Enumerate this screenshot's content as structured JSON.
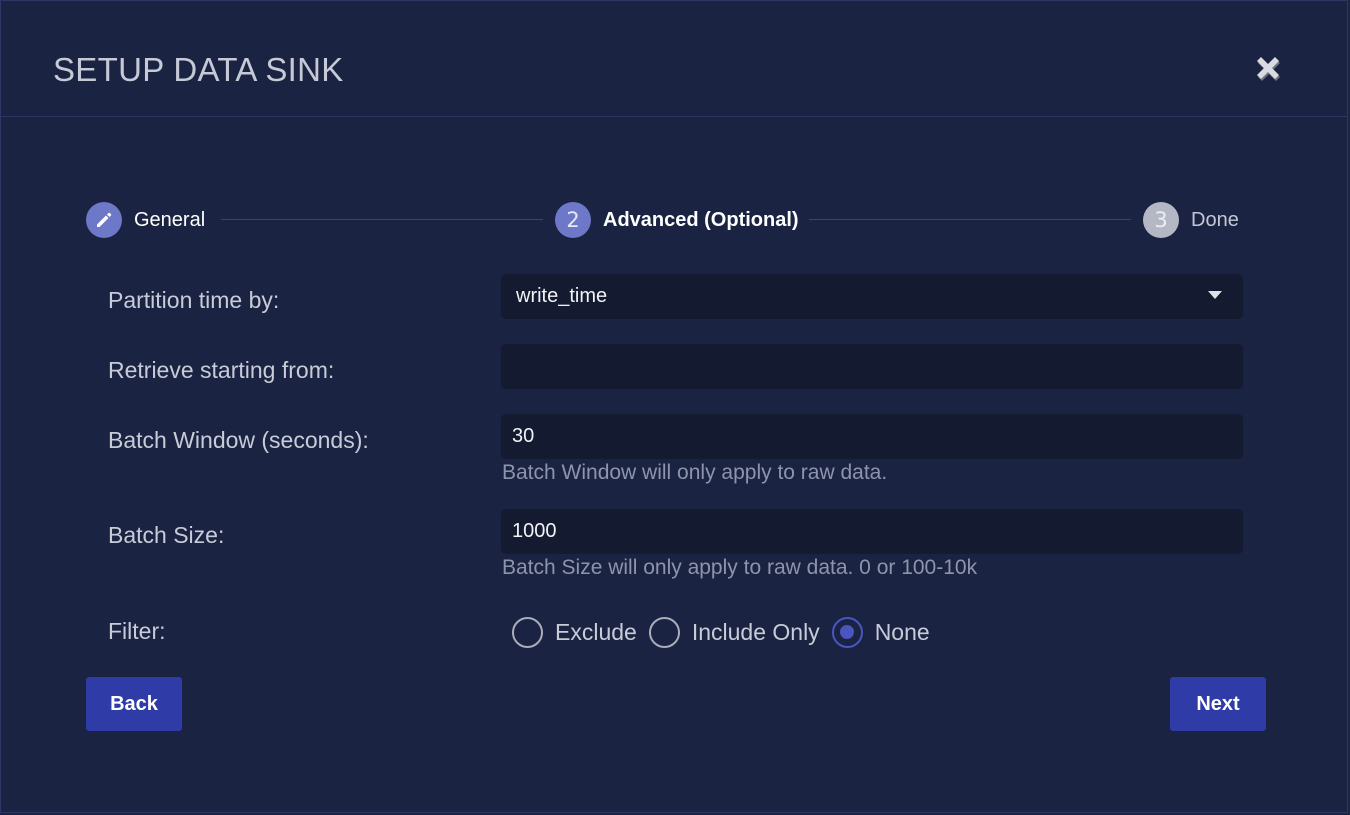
{
  "dialog": {
    "title": "SETUP DATA SINK",
    "close_icon": "close-x-icon"
  },
  "stepper": {
    "steps": [
      {
        "label": "General",
        "marker": "",
        "icon": "pencil-icon",
        "state": "completed"
      },
      {
        "label": "Advanced (Optional)",
        "marker": "2",
        "state": "active"
      },
      {
        "label": "Done",
        "marker": "3",
        "state": "pending"
      }
    ]
  },
  "form": {
    "partition": {
      "label": "Partition time by:",
      "value": "write_time"
    },
    "retrieve": {
      "label": "Retrieve starting from:",
      "value": ""
    },
    "batch_window": {
      "label": "Batch Window (seconds):",
      "value": "30",
      "hint": "Batch Window will only apply to raw data."
    },
    "batch_size": {
      "label": "Batch Size:",
      "value": "1000",
      "hint": "Batch Size will only apply to raw data. 0 or 100-10k"
    },
    "filter": {
      "label": "Filter:",
      "options": [
        "Exclude",
        "Include Only",
        "None"
      ],
      "selected": "None"
    }
  },
  "actions": {
    "back_label": "Back",
    "next_label": "Next"
  },
  "colors": {
    "background": "#1b2342",
    "field_bg": "#141a30",
    "accent": "#2f3ba6",
    "step_active": "#6e78c8",
    "step_pending": "#b4b8c4"
  }
}
